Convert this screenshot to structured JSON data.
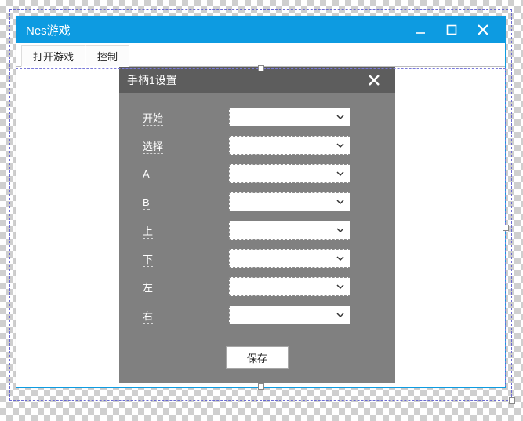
{
  "window": {
    "title": "Nes游戏"
  },
  "menu": {
    "open_game": "打开游戏",
    "control": "控制"
  },
  "dialog": {
    "title": "手柄1设置",
    "labels": {
      "start": "开始",
      "select": "选择",
      "a": "A",
      "b": "B",
      "up": "上",
      "down": "下",
      "left": "左",
      "right": "右"
    },
    "values": {
      "start": "",
      "select": "",
      "a": "",
      "b": "",
      "up": "",
      "down": "",
      "left": "",
      "right": ""
    },
    "save": "保存"
  }
}
